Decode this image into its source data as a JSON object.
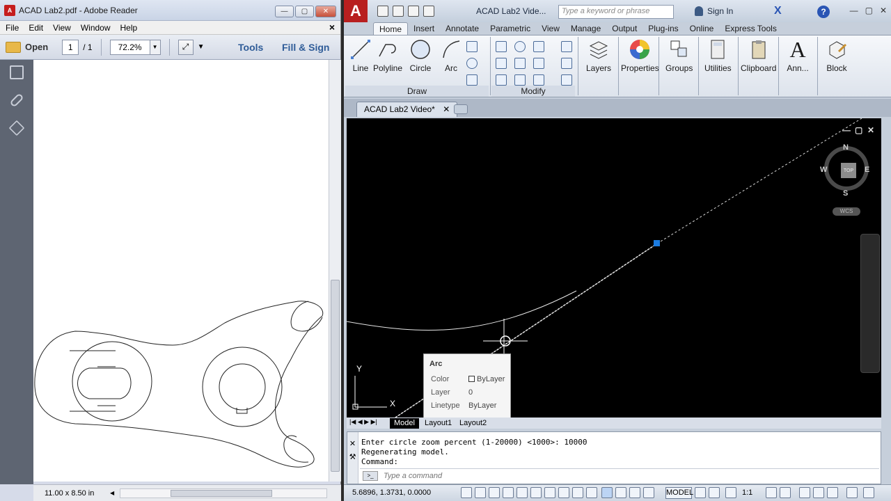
{
  "reader": {
    "title": "ACAD Lab2.pdf - Adobe Reader",
    "menu": [
      "File",
      "Edit",
      "View",
      "Window",
      "Help"
    ],
    "toolbar": {
      "open_label": "Open",
      "page_current": "1",
      "page_total": "/ 1",
      "zoom": "72.2%",
      "tools_label": "Tools",
      "fill_sign_label": "Fill & Sign"
    },
    "page_size": "11.00 x 8.50 in"
  },
  "acad": {
    "title": "ACAD Lab2 Vide...",
    "search_placeholder": "Type a keyword or phrase",
    "sign_in": "Sign In",
    "tabs": [
      "Home",
      "Insert",
      "Annotate",
      "Parametric",
      "View",
      "Manage",
      "Output",
      "Plug-ins",
      "Online",
      "Express Tools"
    ],
    "draw_tools": [
      "Line",
      "Polyline",
      "Circle",
      "Arc"
    ],
    "panels": {
      "draw": "Draw",
      "modify": "Modify"
    },
    "big_buttons": [
      "Layers",
      "Properties",
      "Groups",
      "Utilities",
      "Clipboard",
      "Ann...",
      "Block"
    ],
    "file_tab": "ACAD Lab2 Video*",
    "viewcube": {
      "top": "TOP",
      "n": "N",
      "s": "S",
      "e": "E",
      "w": "W",
      "wcs": "WCS"
    },
    "tooltip": {
      "title": "Arc",
      "rows": [
        {
          "key": "Color",
          "value": "ByLayer"
        },
        {
          "key": "Layer",
          "value": "0"
        },
        {
          "key": "Linetype",
          "value": "ByLayer"
        }
      ]
    },
    "layout_tabs": [
      "Model",
      "Layout1",
      "Layout2"
    ],
    "command_history": [
      "Enter circle zoom percent (1-20000) <1000>: 10000",
      "Regenerating model.",
      "Command:"
    ],
    "command_placeholder": "Type a command",
    "coords": "5.6896, 1.3731, 0.0000",
    "status_model": "MODEL",
    "scale": "1:1"
  }
}
